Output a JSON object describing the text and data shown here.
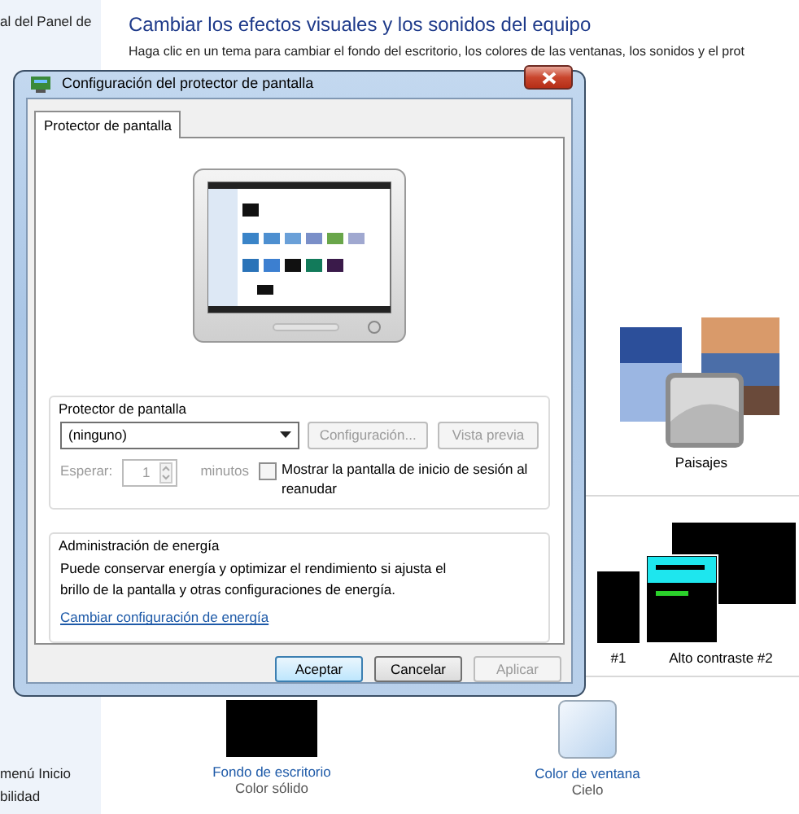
{
  "sidebar": {
    "top_items": [
      "al del Panel de"
    ],
    "bottom_items": [
      "menú Inicio",
      "bilidad"
    ]
  },
  "header": {
    "title": "Cambiar los efectos visuales y los sonidos del equipo",
    "subtitle": "Haga clic en un tema para cambiar el fondo del escritorio, los colores de las ventanas, los sonidos y el prot"
  },
  "themes": [
    {
      "label": "Paisajes",
      "kind": "picture"
    }
  ],
  "contrast_themes": [
    {
      "label": "#1",
      "kind": "cut"
    },
    {
      "label": "Alto contraste #2",
      "kind": "full"
    }
  ],
  "settings": [
    {
      "label": "Fondo de escritorio",
      "value": "Color sólido",
      "kind": "swatch"
    },
    {
      "label": "Color de ventana",
      "value": "Cielo",
      "kind": "glass"
    }
  ],
  "dialog": {
    "title": "Configuración del protector de pantalla",
    "tabs": [
      {
        "label": "Protector de pantalla",
        "selected": true
      }
    ],
    "screensaver": {
      "title": "Protector de pantalla",
      "select": "(ninguno)",
      "buttons": [
        {
          "label": "Configuración...",
          "disabled": true
        },
        {
          "label": "Vista previa",
          "disabled": true
        }
      ],
      "wait_label": "Esperar:",
      "wait_value": "1",
      "wait_unit": "minutos",
      "wait_disabled": true,
      "checkbox": {
        "label": "Mostrar la pantalla de inicio de sesión al reanudar",
        "checked": false
      }
    },
    "power": {
      "title": "Administración de energía",
      "text": "Puede conservar energía y optimizar el rendimiento si ajusta el brillo de la pantalla y otras configuraciones de energía.",
      "link": "Cambiar configuración de energía"
    },
    "buttons": [
      {
        "label": "Aceptar",
        "default": true,
        "disabled": false
      },
      {
        "label": "Cancelar",
        "default": false,
        "disabled": false
      },
      {
        "label": "Aplicar",
        "default": false,
        "disabled": true
      }
    ]
  }
}
